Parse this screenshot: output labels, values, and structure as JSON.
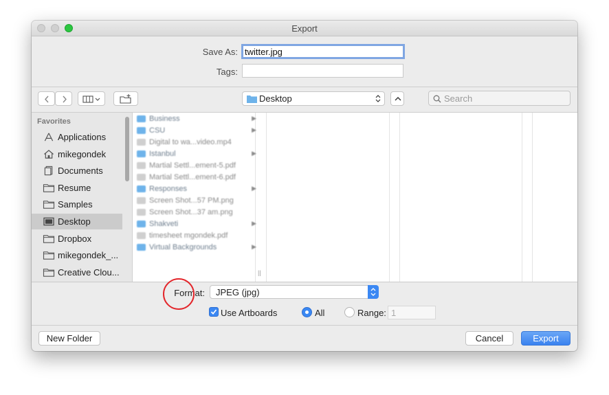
{
  "window": {
    "title": "Export"
  },
  "save": {
    "label": "Save As:",
    "value": "twitter.jpg"
  },
  "tags": {
    "label": "Tags:",
    "value": ""
  },
  "toolbar": {
    "location": "Desktop",
    "search_placeholder": "Search"
  },
  "sidebar": {
    "header": "Favorites",
    "items": [
      {
        "label": "Applications",
        "icon": "applications-icon"
      },
      {
        "label": "mikegondek",
        "icon": "home-icon"
      },
      {
        "label": "Documents",
        "icon": "documents-icon"
      },
      {
        "label": "Resume",
        "icon": "folder-icon"
      },
      {
        "label": "Samples",
        "icon": "folder-icon"
      },
      {
        "label": "Desktop",
        "icon": "desktop-icon",
        "selected": true
      },
      {
        "label": "Dropbox",
        "icon": "folder-icon"
      },
      {
        "label": "mikegondek_...",
        "icon": "folder-icon"
      },
      {
        "label": "Creative Clou...",
        "icon": "folder-icon"
      }
    ]
  },
  "files": [
    {
      "name": "Business",
      "type": "folder",
      "arrow": "▶"
    },
    {
      "name": "CSU",
      "type": "folder",
      "arrow": "▶"
    },
    {
      "name": "Digital to wa...video.mp4",
      "type": "file"
    },
    {
      "name": "Istanbul",
      "type": "folder",
      "arrow": "▶"
    },
    {
      "name": "Martial Settl...ement-5.pdf",
      "type": "file"
    },
    {
      "name": "Martial Settl...ement-6.pdf",
      "type": "file"
    },
    {
      "name": "Responses",
      "type": "folder",
      "arrow": "▶"
    },
    {
      "name": "Screen Shot...57 PM.png",
      "type": "file"
    },
    {
      "name": "Screen Shot...37 am.png",
      "type": "file"
    },
    {
      "name": "Shakveti",
      "type": "folder",
      "arrow": "▶"
    },
    {
      "name": "timesheet mgondek.pdf",
      "type": "file"
    },
    {
      "name": "Virtual Backgrounds",
      "type": "folder",
      "arrow": "▶"
    }
  ],
  "format": {
    "label": "Format:",
    "value": "JPEG (jpg)"
  },
  "options": {
    "use_artboards": "Use Artboards",
    "all": "All",
    "range": "Range:",
    "range_value": "1"
  },
  "buttons": {
    "new_folder": "New Folder",
    "cancel": "Cancel",
    "export": "Export"
  },
  "colors": {
    "accent": "#3b88f3",
    "annotation": "#e3262b",
    "folder": "#6eb3ea"
  }
}
